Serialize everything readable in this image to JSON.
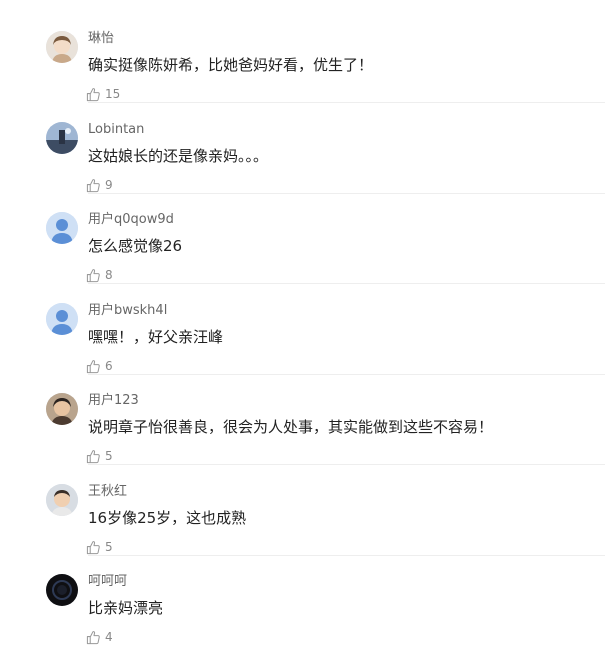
{
  "comments": [
    {
      "username": "琳怡",
      "text": "确实挺像陈妍希，比她爸妈好看，优生了！",
      "likes": "15",
      "avatar": "photo-girl"
    },
    {
      "username": "Lobintan",
      "text": "这姑娘长的还是像亲妈。。。",
      "likes": "9",
      "avatar": "photo-landscape"
    },
    {
      "username": "用户q0qow9d",
      "text": "怎么感觉像26",
      "likes": "8",
      "avatar": "default-user-icon"
    },
    {
      "username": "用户bwskh4l",
      "text": "嘿嘿！，好父亲汪峰",
      "likes": "6",
      "avatar": "default-user-icon"
    },
    {
      "username": "用户123",
      "text": "说明章子怡很善良，很会为人处事，其实能做到这些不容易！",
      "likes": "5",
      "avatar": "photo-child"
    },
    {
      "username": "王秋红",
      "text": "16岁像25岁，这也成熟",
      "likes": "5",
      "avatar": "photo-boy"
    },
    {
      "username": "呵呵呵",
      "text": "比亲妈漂亮",
      "likes": "4",
      "avatar": "photo-dark-circle"
    }
  ],
  "colors": {
    "username": "#666666",
    "text": "#222222",
    "likes": "#888888",
    "divider": "#eeeeee",
    "default_avatar": "#5b8fd6"
  },
  "icons": {
    "like": "thumbs-up-icon"
  }
}
